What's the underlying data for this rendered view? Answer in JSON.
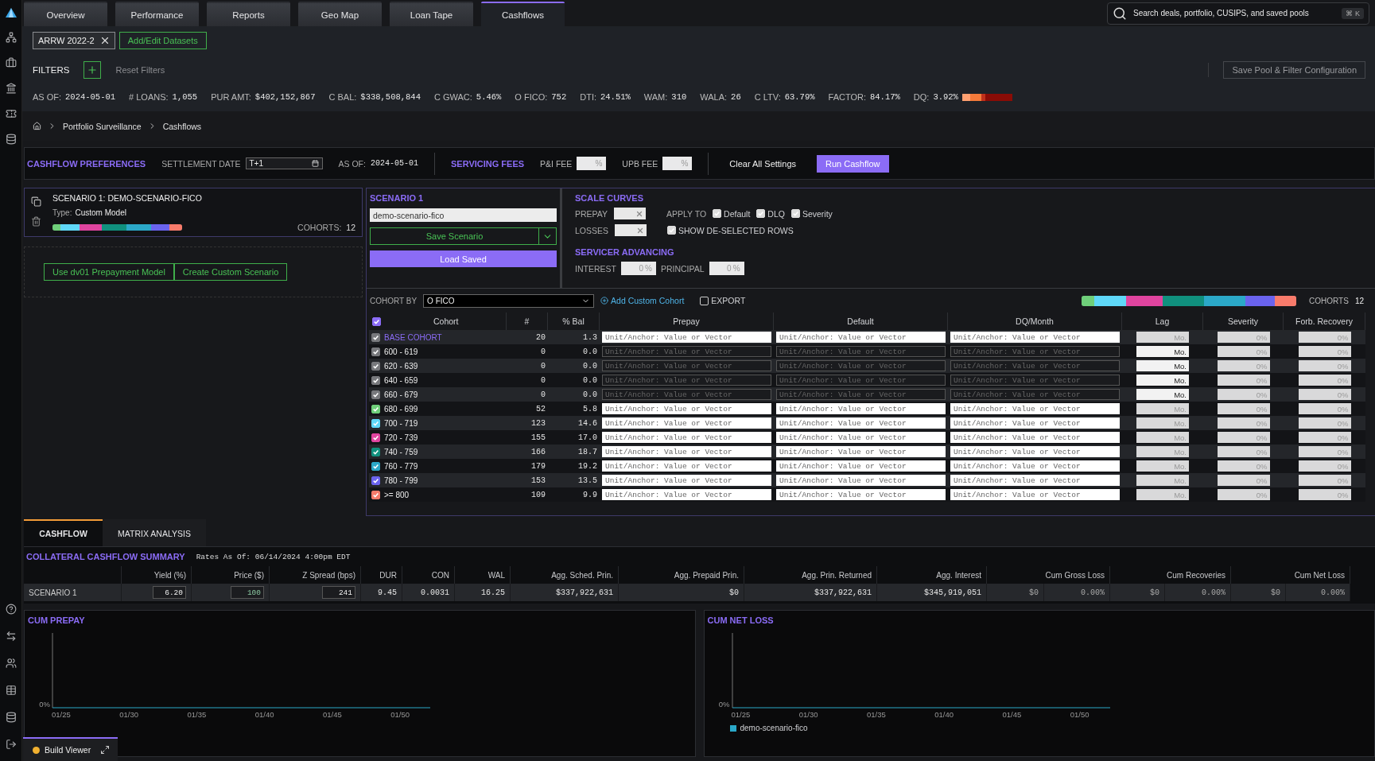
{
  "tabs": [
    {
      "label": "Overview",
      "selected": false
    },
    {
      "label": "Performance",
      "selected": false
    },
    {
      "label": "Reports",
      "selected": false
    },
    {
      "label": "Geo Map",
      "selected": false
    },
    {
      "label": "Loan Tape",
      "selected": false
    },
    {
      "label": "Cashflows",
      "selected": true
    }
  ],
  "search": {
    "placeholder": "Search deals, portfolio, CUSIPS, and saved pools",
    "shortcut": "⌘ K"
  },
  "datasets": {
    "chips": [
      "ARRW 2022-2"
    ],
    "edit_button": "Add/Edit Datasets"
  },
  "filters": {
    "label": "FILTERS",
    "reset": "Reset Filters",
    "save": "Save Pool & Filter Configuration"
  },
  "stats": [
    {
      "label": "AS OF:",
      "value": "2024-05-01"
    },
    {
      "label": "# LOANS:",
      "value": "1,055"
    },
    {
      "label": "PUR AMT:",
      "value": "$402,152,867"
    },
    {
      "label": "C BAL:",
      "value": "$338,508,844"
    },
    {
      "label": "C GWAC:",
      "value": "5.46%"
    },
    {
      "label": "O FICO:",
      "value": "752"
    },
    {
      "label": "DTI:",
      "value": "24.51%"
    },
    {
      "label": "WAM:",
      "value": "310"
    },
    {
      "label": "WALA:",
      "value": "26"
    },
    {
      "label": "C LTV:",
      "value": "63.79%"
    },
    {
      "label": "FACTOR:",
      "value": "84.17%"
    },
    {
      "label": "DQ:",
      "value": "3.92%"
    }
  ],
  "breadcrumb": [
    "Portfolio Surveillance",
    "Cashflows"
  ],
  "preferences": {
    "title": "CASHFLOW PREFERENCES",
    "settlement_label": "SETTLEMENT DATE",
    "settlement_value": "T+1",
    "as_of_label": "AS OF:",
    "as_of_value": "2024-05-01",
    "fees_title": "SERVICING FEES",
    "fees": [
      {
        "label": "P&I FEE",
        "unit": "%"
      },
      {
        "label": "UPB FEE",
        "unit": "%"
      }
    ],
    "clear_button": "Clear All Settings",
    "run_button": "Run Cashflow"
  },
  "scenario_card": {
    "title": "SCENARIO 1: DEMO-SCENARIO-FICO",
    "type_label": "Type:",
    "type": "Custom Model",
    "cohorts_label": "COHORTS:",
    "cohorts": "12"
  },
  "scenario_actions": [
    "Use dv01 Prepayment Model",
    "Create Custom Scenario"
  ],
  "scenario_editor": {
    "title": "SCENARIO 1",
    "name": "demo-scenario-fico",
    "save": "Save Scenario",
    "load": "Load Saved"
  },
  "scale_curves": {
    "title": "SCALE CURVES",
    "prepay_label": "PREPAY",
    "losses_label": "LOSSES",
    "apply_label": "APPLY TO",
    "apply": [
      {
        "label": "Default",
        "checked": true
      },
      {
        "label": "DLQ",
        "checked": true
      },
      {
        "label": "Severity",
        "checked": true
      }
    ],
    "show_deselected": {
      "label": "SHOW DE-SELECTED ROWS",
      "checked": true
    }
  },
  "servicer_advancing": {
    "title": "SERVICER ADVANCING",
    "fields": [
      {
        "label": "INTEREST",
        "placeholder": "0",
        "unit": "%"
      },
      {
        "label": "PRINCIPAL",
        "placeholder": "0",
        "unit": "%"
      }
    ]
  },
  "cohort_bar": {
    "label": "COHORT BY",
    "value": "O FICO",
    "add": "Add Custom Cohort",
    "export": {
      "label": "EXPORT",
      "checked": false
    },
    "cohorts_label": "COHORTS",
    "cohorts": "12"
  },
  "cohort_table": {
    "header_checked": true,
    "columns": [
      "Cohort",
      "#",
      "% Bal",
      "Prepay",
      "Default",
      "DQ/Month",
      "Lag",
      "Severity",
      "Forb. Recovery"
    ],
    "rows": [
      {
        "cohort": "BASE COHORT",
        "kind": "base",
        "count": "20",
        "pct_bal": "1.3",
        "checked": true,
        "color": "#77787c",
        "disabled": false,
        "prepay_placeholder": "Unit/Anchor: Value or Vector",
        "default_placeholder": "Unit/Anchor: Value or Vector",
        "dq_placeholder": "Unit/Anchor: Value or Vector",
        "lag": "Mo.",
        "severity": "0%",
        "forb": "0%"
      },
      {
        "cohort": "600 - 619",
        "kind": "range",
        "count": "0",
        "pct_bal": "0.0",
        "checked": true,
        "color": "#77787c",
        "disabled": true,
        "prepay_placeholder": "Unit/Anchor: Value or Vector",
        "default_placeholder": "Unit/Anchor: Value or Vector",
        "dq_placeholder": "Unit/Anchor: Value or Vector",
        "lag": "Mo.",
        "severity": "0%",
        "forb": "0%"
      },
      {
        "cohort": "620 - 639",
        "kind": "range",
        "count": "0",
        "pct_bal": "0.0",
        "checked": true,
        "color": "#77787c",
        "disabled": true,
        "prepay_placeholder": "Unit/Anchor: Value or Vector",
        "default_placeholder": "Unit/Anchor: Value or Vector",
        "dq_placeholder": "Unit/Anchor: Value or Vector",
        "lag": "Mo.",
        "severity": "0%",
        "forb": "0%"
      },
      {
        "cohort": "640 - 659",
        "kind": "range",
        "count": "0",
        "pct_bal": "0.0",
        "checked": true,
        "color": "#77787c",
        "disabled": true,
        "prepay_placeholder": "Unit/Anchor: Value or Vector",
        "default_placeholder": "Unit/Anchor: Value or Vector",
        "dq_placeholder": "Unit/Anchor: Value or Vector",
        "lag": "Mo.",
        "severity": "0%",
        "forb": "0%"
      },
      {
        "cohort": "660 - 679",
        "kind": "range",
        "count": "0",
        "pct_bal": "0.0",
        "checked": true,
        "color": "#77787c",
        "disabled": true,
        "prepay_placeholder": "Unit/Anchor: Value or Vector",
        "default_placeholder": "Unit/Anchor: Value or Vector",
        "dq_placeholder": "Unit/Anchor: Value or Vector",
        "lag": "Mo.",
        "severity": "0%",
        "forb": "0%"
      },
      {
        "cohort": "680 - 699",
        "kind": "range",
        "count": "52",
        "pct_bal": "5.8",
        "checked": true,
        "disabled": false,
        "color": "#6fcf7a",
        "prepay_placeholder": "Unit/Anchor: Value or Vector",
        "default_placeholder": "Unit/Anchor: Value or Vector",
        "dq_placeholder": "Unit/Anchor: Value or Vector",
        "lag": "Mo.",
        "severity": "0%",
        "forb": "0%"
      },
      {
        "cohort": "700 - 719",
        "kind": "range",
        "count": "123",
        "pct_bal": "14.6",
        "checked": true,
        "disabled": false,
        "color": "#5fd8f8",
        "prepay_placeholder": "Unit/Anchor: Value or Vector",
        "default_placeholder": "Unit/Anchor: Value or Vector",
        "dq_placeholder": "Unit/Anchor: Value or Vector",
        "lag": "Mo.",
        "severity": "0%",
        "forb": "0%"
      },
      {
        "cohort": "720 - 739",
        "kind": "range",
        "count": "155",
        "pct_bal": "17.0",
        "checked": true,
        "disabled": false,
        "color": "#e0449f",
        "prepay_placeholder": "Unit/Anchor: Value or Vector",
        "default_placeholder": "Unit/Anchor: Value or Vector",
        "dq_placeholder": "Unit/Anchor: Value or Vector",
        "lag": "Mo.",
        "severity": "0%",
        "forb": "0%"
      },
      {
        "cohort": "740 - 759",
        "kind": "range",
        "count": "166",
        "pct_bal": "18.7",
        "checked": true,
        "disabled": false,
        "color": "#10907e",
        "prepay_placeholder": "Unit/Anchor: Value or Vector",
        "default_placeholder": "Unit/Anchor: Value or Vector",
        "dq_placeholder": "Unit/Anchor: Value or Vector",
        "lag": "Mo.",
        "severity": "0%",
        "forb": "0%"
      },
      {
        "cohort": "760 - 779",
        "kind": "range",
        "count": "179",
        "pct_bal": "19.2",
        "checked": true,
        "disabled": false,
        "color": "#2ba8c8",
        "prepay_placeholder": "Unit/Anchor: Value or Vector",
        "default_placeholder": "Unit/Anchor: Value or Vector",
        "dq_placeholder": "Unit/Anchor: Value or Vector",
        "lag": "Mo.",
        "severity": "0%",
        "forb": "0%"
      },
      {
        "cohort": "780 - 799",
        "kind": "range",
        "count": "153",
        "pct_bal": "13.5",
        "checked": true,
        "disabled": false,
        "color": "#6a63ee",
        "prepay_placeholder": "Unit/Anchor: Value or Vector",
        "default_placeholder": "Unit/Anchor: Value or Vector",
        "dq_placeholder": "Unit/Anchor: Value or Vector",
        "lag": "Mo.",
        "severity": "0%",
        "forb": "0%"
      },
      {
        "cohort": ">= 800",
        "kind": "range",
        "count": "109",
        "pct_bal": "9.9",
        "checked": true,
        "disabled": false,
        "color": "#f87b6b",
        "prepay_placeholder": "Unit/Anchor: Value or Vector",
        "default_placeholder": "Unit/Anchor: Value or Vector",
        "dq_placeholder": "Unit/Anchor: Value or Vector",
        "lag": "Mo.",
        "severity": "0%",
        "forb": "0%"
      }
    ]
  },
  "bottom_tabs": [
    {
      "label": "CASHFLOW",
      "selected": true
    },
    {
      "label": "MATRIX ANALYSIS",
      "selected": false
    }
  ],
  "summary": {
    "title": "COLLATERAL CASHFLOW SUMMARY",
    "rates_as_of": "Rates As Of: 06/14/2024 4:00pm EDT",
    "columns": [
      "Yield (%)",
      "Price ($)",
      "Z Spread (bps)",
      "DUR",
      "CON",
      "WAL",
      "Agg. Sched. Prin.",
      "Agg. Prepaid Prin.",
      "Agg. Prin. Returned",
      "Agg. Interest",
      "Cum Gross Loss",
      "Cum Recoveries",
      "Cum Net Loss"
    ],
    "rows": [
      {
        "name": "SCENARIO 1",
        "cells": [
          {
            "kind": "input",
            "value": "6.20"
          },
          {
            "kind": "input",
            "placeholder": "100"
          },
          {
            "kind": "input",
            "value": "241"
          },
          {
            "kind": "text",
            "value": "9.45"
          },
          {
            "kind": "text",
            "value": "0.0031"
          },
          {
            "kind": "text",
            "value": "16.25"
          },
          {
            "kind": "text",
            "value": "$337,922,631"
          },
          {
            "kind": "text",
            "value": "$0"
          },
          {
            "kind": "text",
            "value": "$337,922,631"
          },
          {
            "kind": "text",
            "value": "$345,919,051"
          },
          {
            "kind": "pair",
            "values": [
              "$0",
              "0.00%"
            ]
          },
          {
            "kind": "pair",
            "values": [
              "$0",
              "0.00%"
            ]
          },
          {
            "kind": "pair",
            "values": [
              "$0",
              "0.00%"
            ]
          }
        ]
      }
    ]
  },
  "charts": [
    {
      "title": "CUM PREPAY",
      "y_tick": "0%",
      "x_ticks": [
        "01/25",
        "01/30",
        "01/35",
        "01/40",
        "01/45",
        "01/50"
      ]
    },
    {
      "title": "CUM NET LOSS",
      "y_tick": "0%",
      "x_ticks": [
        "01/25",
        "01/30",
        "01/35",
        "01/40",
        "01/45",
        "01/50"
      ],
      "legend": "demo-scenario-fico"
    }
  ],
  "build_viewer": {
    "label": "Build Viewer"
  }
}
